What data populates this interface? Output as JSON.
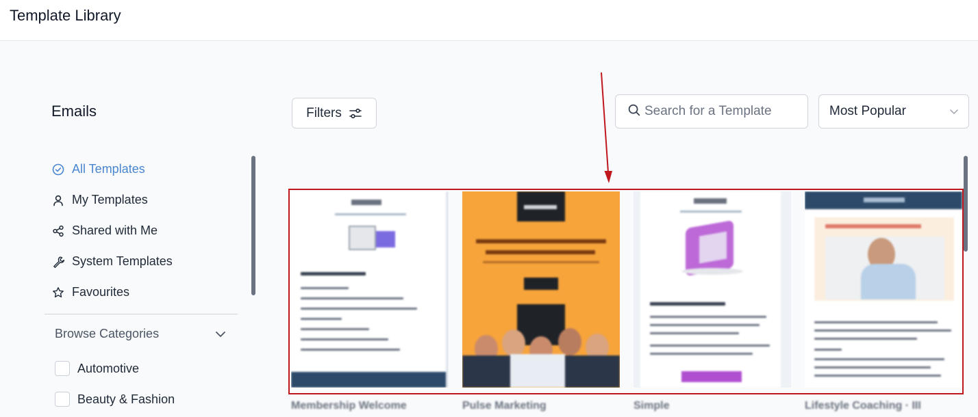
{
  "app": {
    "title": "Template Library"
  },
  "sidebar": {
    "heading": "Emails",
    "items": [
      {
        "label": "All Templates",
        "icon": "check-circle-icon",
        "active": true
      },
      {
        "label": "My Templates",
        "icon": "user-icon",
        "active": false
      },
      {
        "label": "Shared with Me",
        "icon": "share-icon",
        "active": false
      },
      {
        "label": "System Templates",
        "icon": "wrench-icon",
        "active": false
      },
      {
        "label": "Favourites",
        "icon": "star-icon",
        "active": false
      }
    ],
    "browse_label": "Browse Categories",
    "categories": [
      {
        "label": "Automotive",
        "checked": false
      },
      {
        "label": "Beauty & Fashion",
        "checked": false
      }
    ]
  },
  "toolbar": {
    "filters_label": "Filters",
    "search_placeholder": "Search for a Template",
    "sort_value": "Most Popular"
  },
  "templates": [
    {
      "name": "Membership Welcome",
      "theme_color": "#2d4a6b"
    },
    {
      "name": "Pulse Marketing",
      "theme_color": "#f7a43b"
    },
    {
      "name": "Simple",
      "theme_color": "#b14fd1"
    },
    {
      "name": "Lifestyle Coaching · III",
      "theme_color": "#2d4a6b"
    }
  ],
  "colors": {
    "accent": "#4a86d0",
    "highlight_border": "#c0161d"
  }
}
